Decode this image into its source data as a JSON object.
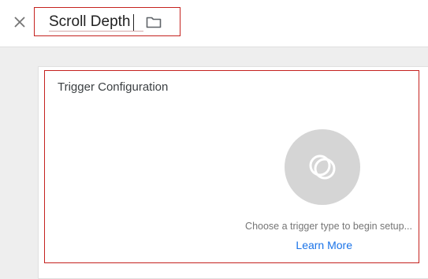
{
  "header": {
    "close_icon": "close-icon",
    "trigger_name": "Scroll Depth",
    "folder_icon": "folder-icon"
  },
  "trigger_config": {
    "title": "Trigger Configuration",
    "placeholder_icon": "trigger-type-icon",
    "hint": "Choose a trigger type to begin setup...",
    "learn_more": "Learn More"
  },
  "colors": {
    "accent_link": "#1a73e8",
    "highlight_border": "#c5221f"
  }
}
